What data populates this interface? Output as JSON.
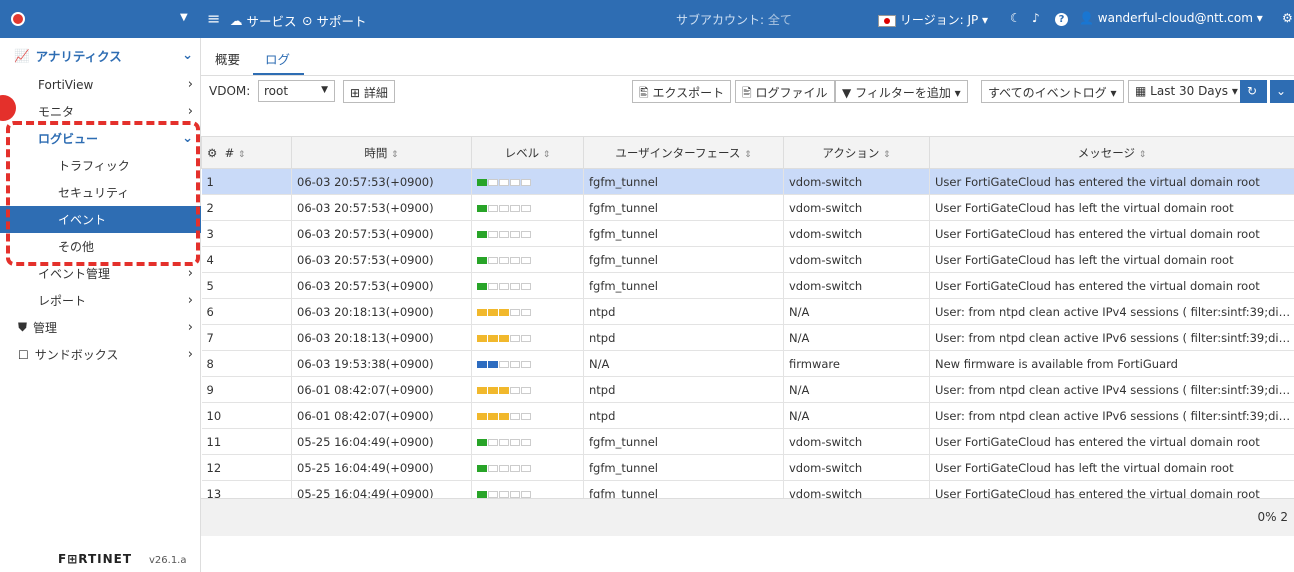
{
  "topbar": {
    "services": "サービス",
    "support": "サポート",
    "sub_account_label": "サブアカウント:",
    "sub_account_value": "全て",
    "region": "リージョン: JP",
    "user": "wanderful-cloud@ntt.com"
  },
  "sidebar": {
    "analytics": "アナリティクス",
    "fortiview": "FortiView",
    "monitor": "モニタ",
    "logview": "ログビュー",
    "traffic": "トラフィック",
    "security": "セキュリティ",
    "event": "イベント",
    "other": "その他",
    "event_mgmt": "イベント管理",
    "report": "レポート",
    "admin": "管理",
    "sandbox": "サンドボックス",
    "brand": "F⊞RTINET",
    "version": "v26.1.a"
  },
  "tabs": {
    "overview": "概要",
    "log": "ログ"
  },
  "toolbar": {
    "vdom_label": "VDOM:",
    "vdom_value": "root",
    "details": "詳細",
    "export": "エクスポート",
    "logfile": "ログファイル",
    "add_filter": "フィルターを追加",
    "all_events": "すべてのイベントログ",
    "range": "Last 30 Days"
  },
  "table": {
    "headers": [
      "#",
      "時間",
      "レベル",
      "ユーザインターフェース",
      "アクション",
      "メッセージ"
    ],
    "rows": [
      {
        "num": "1",
        "time": "06-03 20:57:53(+0900)",
        "level": "g1",
        "ui": "fgfm_tunnel",
        "action": "vdom-switch",
        "msg": "User FortiGateCloud has entered the virtual domain root"
      },
      {
        "num": "2",
        "time": "06-03 20:57:53(+0900)",
        "level": "g1",
        "ui": "fgfm_tunnel",
        "action": "vdom-switch",
        "msg": "User FortiGateCloud has left the virtual domain root"
      },
      {
        "num": "3",
        "time": "06-03 20:57:53(+0900)",
        "level": "g1",
        "ui": "fgfm_tunnel",
        "action": "vdom-switch",
        "msg": "User FortiGateCloud has entered the virtual domain root"
      },
      {
        "num": "4",
        "time": "06-03 20:57:53(+0900)",
        "level": "g1",
        "ui": "fgfm_tunnel",
        "action": "vdom-switch",
        "msg": "User FortiGateCloud has left the virtual domain root"
      },
      {
        "num": "5",
        "time": "06-03 20:57:53(+0900)",
        "level": "g1",
        "ui": "fgfm_tunnel",
        "action": "vdom-switch",
        "msg": "User FortiGateCloud has entered the virtual domain root"
      },
      {
        "num": "6",
        "time": "06-03 20:18:13(+0900)",
        "level": "y3",
        "ui": "ntpd",
        "action": "N/A",
        "msg": "User: from ntpd clean active IPv4 sessions ( filter:sintf:39;dintf:25;pr..."
      },
      {
        "num": "7",
        "time": "06-03 20:18:13(+0900)",
        "level": "y3",
        "ui": "ntpd",
        "action": "N/A",
        "msg": "User: from ntpd clean active IPv6 sessions ( filter:sintf:39;dintf:25;pr..."
      },
      {
        "num": "8",
        "time": "06-03 19:53:38(+0900)",
        "level": "b2",
        "ui": "N/A",
        "action": "firmware",
        "msg": "New firmware is available from FortiGuard"
      },
      {
        "num": "9",
        "time": "06-01 08:42:07(+0900)",
        "level": "y3",
        "ui": "ntpd",
        "action": "N/A",
        "msg": "User: from ntpd clean active IPv4 sessions ( filter:sintf:39;dintf:25;pr..."
      },
      {
        "num": "10",
        "time": "06-01 08:42:07(+0900)",
        "level": "y3",
        "ui": "ntpd",
        "action": "N/A",
        "msg": "User: from ntpd clean active IPv6 sessions ( filter:sintf:39;dintf:25;pr..."
      },
      {
        "num": "11",
        "time": "05-25 16:04:49(+0900)",
        "level": "g1",
        "ui": "fgfm_tunnel",
        "action": "vdom-switch",
        "msg": "User FortiGateCloud has entered the virtual domain root"
      },
      {
        "num": "12",
        "time": "05-25 16:04:49(+0900)",
        "level": "g1",
        "ui": "fgfm_tunnel",
        "action": "vdom-switch",
        "msg": "User FortiGateCloud has left the virtual domain root"
      },
      {
        "num": "13",
        "time": "05-25 16:04:49(+0900)",
        "level": "g1",
        "ui": "fgfm_tunnel",
        "action": "vdom-switch",
        "msg": "User FortiGateCloud has entered the virtual domain root"
      }
    ]
  },
  "footer": {
    "progress": "0% 2"
  }
}
